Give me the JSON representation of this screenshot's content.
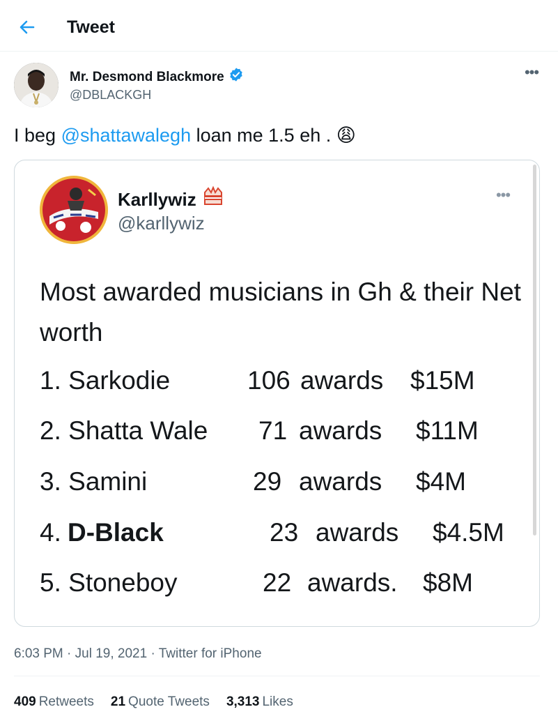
{
  "header": {
    "title": "Tweet"
  },
  "tweet": {
    "author_name": "Mr. Desmond Blackmore",
    "author_handle": "@DBLACKGH",
    "text_before": "I beg ",
    "mention": "@shattawalegh",
    "text_after": " loan me 1.5 eh . ",
    "emoji": "😩",
    "timestamp": "6:03 PM",
    "sep1": " · ",
    "date": "Jul 19, 2021",
    "sep2": " · ",
    "source": "Twitter for iPhone"
  },
  "quote": {
    "author_name": "Karllywiz",
    "author_handle": "@karllywiz",
    "text": "Most awarded musicians in Gh & their Net worth",
    "rows": [
      {
        "name": "1. Sarkodie",
        "count": "106",
        "awards": "awards",
        "worth": "$15M"
      },
      {
        "name_prefix": "2. ",
        "name": "2. Shatta Wale",
        "count": "71",
        "awards": "awards",
        "worth": "$11M"
      },
      {
        "name": "3. Samini",
        "count": "29",
        "awards": "awards",
        "worth": "$4M"
      },
      {
        "name_prefix": "4. ",
        "name_bold": "D-Black",
        "count": "23",
        "awards": "awards",
        "worth": "$4.5M"
      },
      {
        "name": "5. Stoneboy",
        "count": "22",
        "awards": "awards.",
        "worth": "$8M"
      }
    ]
  },
  "stats": {
    "retweets_count": "409",
    "retweets_label": "Retweets",
    "quotes_count": "21",
    "quotes_label": "Quote Tweets",
    "likes_count": "3,313",
    "likes_label": "Likes"
  },
  "colors": {
    "accent": "#1d9bf0",
    "verified": "#1d9bf0",
    "secondary": "#536471"
  }
}
